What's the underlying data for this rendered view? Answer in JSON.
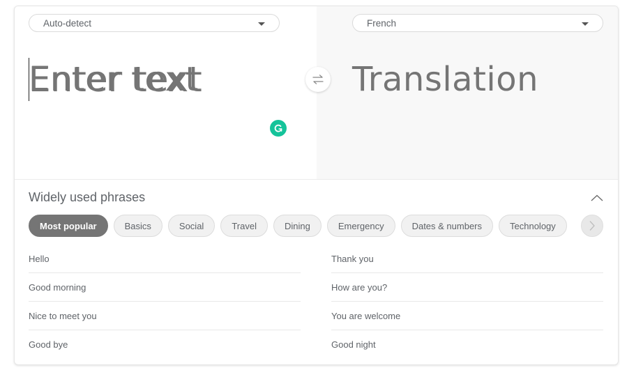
{
  "translator": {
    "source_language": "Auto-detect",
    "target_language": "French",
    "source_placeholder": "Enter text",
    "source_value": "",
    "translation_placeholder": "Translation",
    "icons": {
      "dropdown": "caret-down-icon",
      "swap": "swap-arrows-icon",
      "grammarly": "grammarly-icon"
    }
  },
  "phrases": {
    "title": "Widely used phrases",
    "collapse_icon": "chevron-up-icon",
    "next_icon": "chevron-right-icon",
    "categories": [
      {
        "label": "Most popular",
        "active": true
      },
      {
        "label": "Basics",
        "active": false
      },
      {
        "label": "Social",
        "active": false
      },
      {
        "label": "Travel",
        "active": false
      },
      {
        "label": "Dining",
        "active": false
      },
      {
        "label": "Emergency",
        "active": false
      },
      {
        "label": "Dates & numbers",
        "active": false
      },
      {
        "label": "Technology",
        "active": false
      }
    ],
    "left_column": [
      "Hello",
      "Good morning",
      "Nice to meet you",
      "Good bye"
    ],
    "right_column": [
      "Thank you",
      "How are you?",
      "You are welcome",
      "Good night"
    ]
  },
  "colors": {
    "active_chip": "#757575",
    "grammarly": "#15c39a",
    "right_pane_bg": "#f8f8f8"
  }
}
